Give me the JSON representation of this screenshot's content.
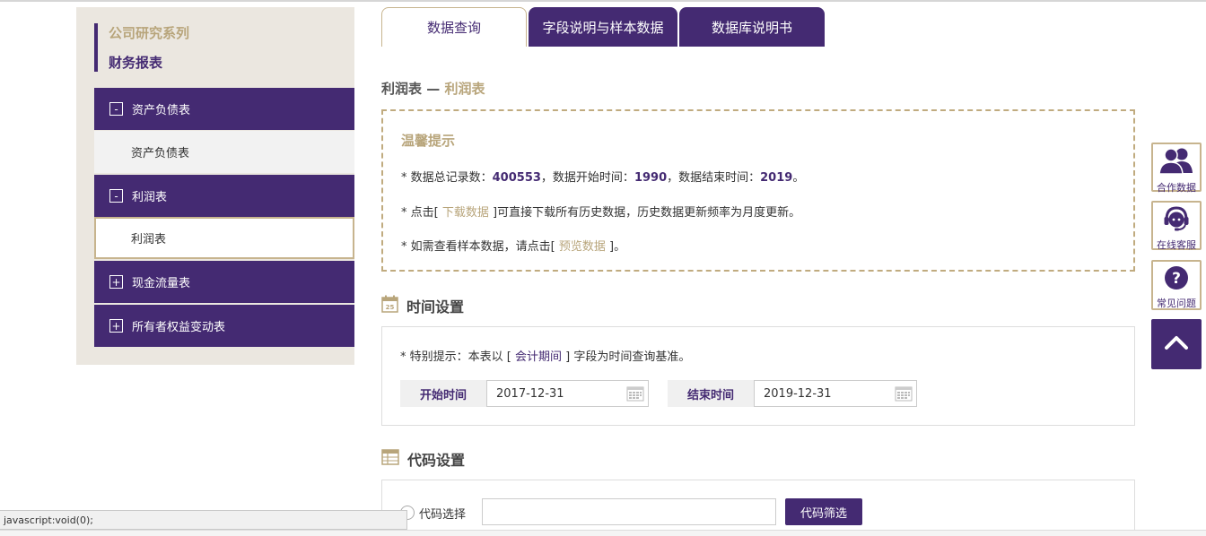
{
  "sidebar": {
    "title": "公司研究系列",
    "subtitle": "财务报表",
    "categories": [
      {
        "toggle": "-",
        "label": "资产负债表",
        "sub": "资产负债表"
      },
      {
        "toggle": "-",
        "label": "利润表",
        "sub": "利润表"
      },
      {
        "toggle": "+",
        "label": "现金流量表"
      },
      {
        "toggle": "+",
        "label": "所有者权益变动表"
      }
    ]
  },
  "tabs": [
    {
      "label": "数据查询",
      "active": true
    },
    {
      "label": "字段说明与样本数据",
      "active": false
    },
    {
      "label": "数据库说明书",
      "active": false
    }
  ],
  "breadcrumb": {
    "parent": "利润表 —",
    "current": "利润表"
  },
  "tips": {
    "title": "温馨提示",
    "line1": {
      "prefix": "* 数据总记录数：",
      "count": "400553",
      "mid1": "，数据开始时间：",
      "start": "1990",
      "mid2": "，数据结束时间：",
      "end": "2019",
      "suffix": "。"
    },
    "line2": {
      "prefix": "* 点击[ ",
      "link": "下载数据",
      "suffix": " ]可直接下载所有历史数据，历史数据更新频率为月度更新。"
    },
    "line3": {
      "prefix": "* 如需查看样本数据，请点击[ ",
      "link": "预览数据",
      "suffix": " ]。"
    }
  },
  "time_settings": {
    "title": "时间设置",
    "note_prefix": "* 特别提示：本表以 [ ",
    "note_field": "会计期间",
    "note_suffix": " ] 字段为时间查询基准。",
    "start_label": "开始时间",
    "start_value": "2017-12-31",
    "end_label": "结束时间",
    "end_value": "2019-12-31"
  },
  "code_settings": {
    "title": "代码设置",
    "radio_label": "代码选择",
    "input_value": "",
    "filter_button": "代码筛选"
  },
  "float_bar": {
    "items": [
      {
        "label": "合作数据",
        "icon": "partners-icon"
      },
      {
        "label": "在线客服",
        "icon": "headset-icon"
      },
      {
        "label": "常见问题",
        "icon": "question-icon"
      }
    ],
    "back_to_top_icon": "chevron-up-icon"
  },
  "status_bar": "javascript:void(0);",
  "colors": {
    "purple": "#442a72",
    "gold": "#b8a57b"
  }
}
